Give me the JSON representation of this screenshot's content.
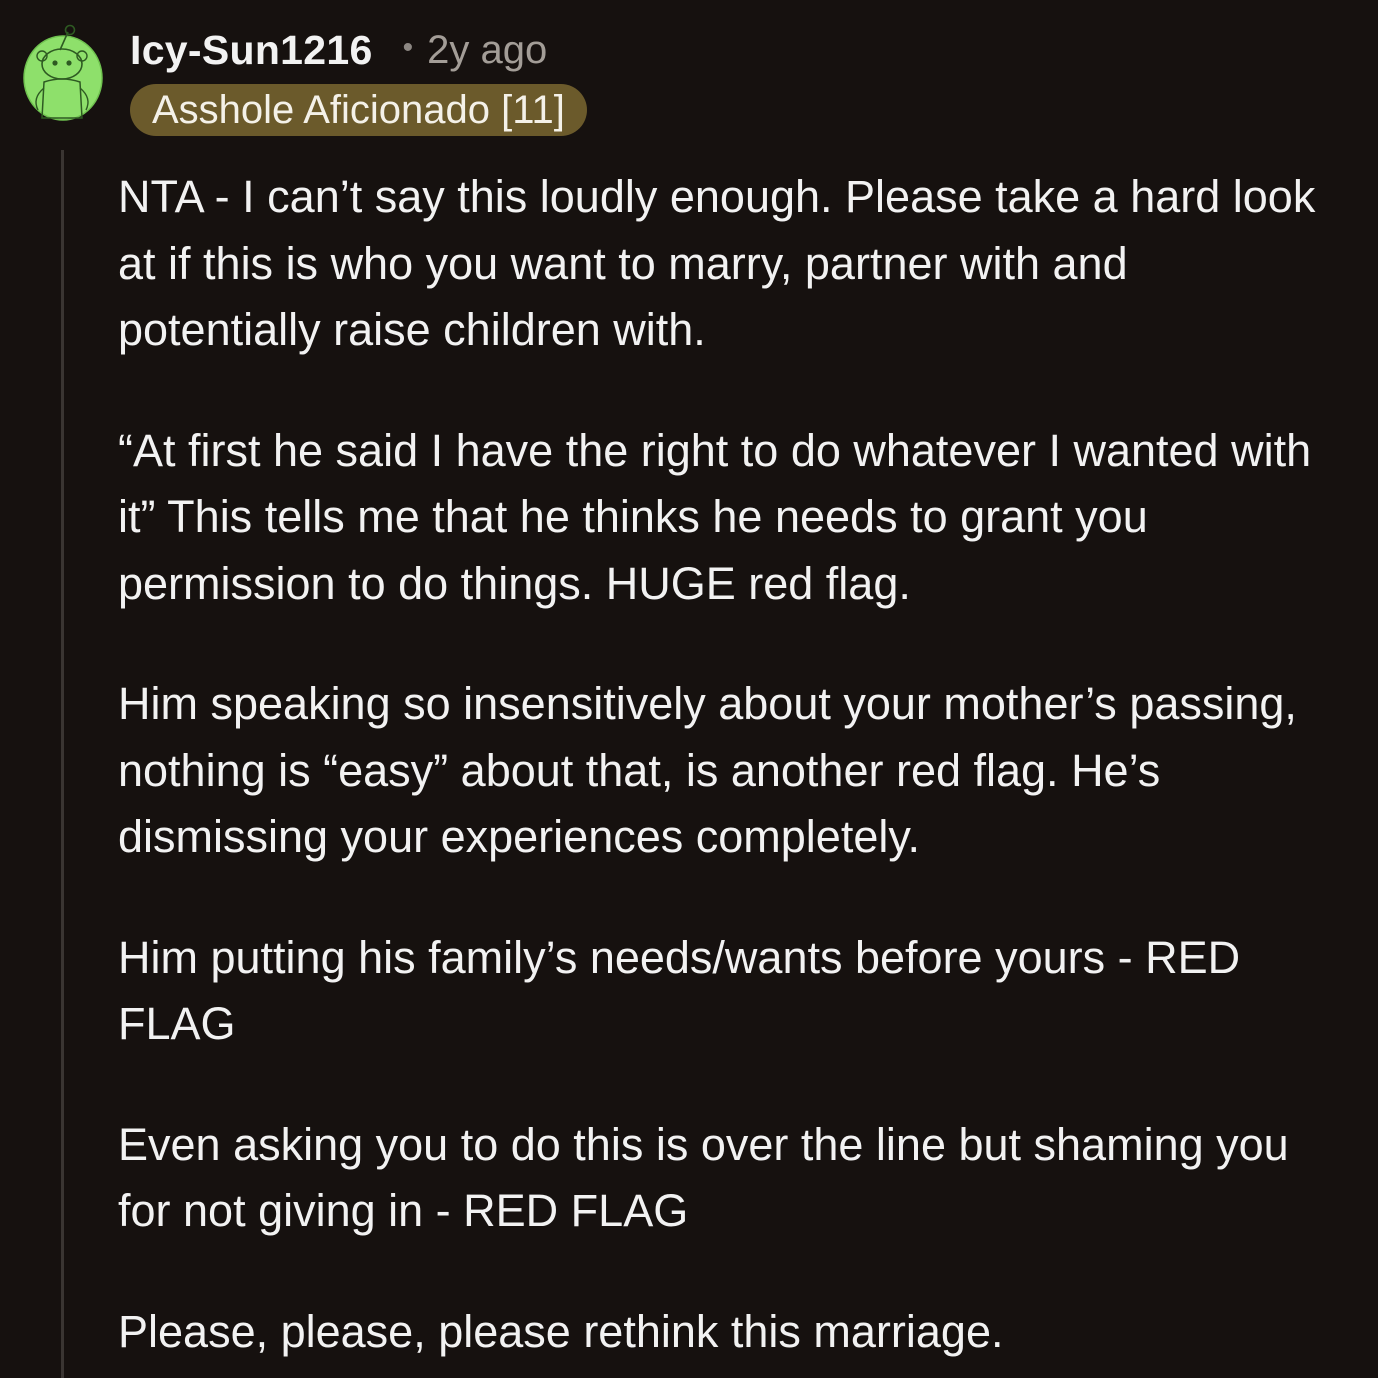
{
  "comment": {
    "author": "Icy-Sun1216",
    "separator": "•",
    "age": "2y ago",
    "flair": "Asshole Aficionado [11]",
    "flair_color": "#6b5a2b",
    "avatar_icon": "snoo-avatar-icon",
    "avatar_color": "#8ee06b",
    "paragraphs": [
      "NTA - I can’t say this loudly enough. Please take a hard look at if this is who you want to marry, partner with and potentially raise children with.",
      "“At first he said I have the right to do whatever I wanted with it” This tells me that he thinks he needs to grant you permission to do things. HUGE red flag.",
      "Him speaking so insensitively about your mother’s passing, nothing is “easy” about that, is another red flag. He’s dismissing your experiences completely.",
      "Him putting his family’s needs/wants before yours - RED FLAG",
      "Even asking you to do this is over the line but shaming you for not giving in - RED FLAG",
      "Please, please, please rethink this marriage."
    ]
  },
  "theme": {
    "background": "#16110f",
    "text": "#f2f2f2",
    "muted": "#a39d97"
  }
}
